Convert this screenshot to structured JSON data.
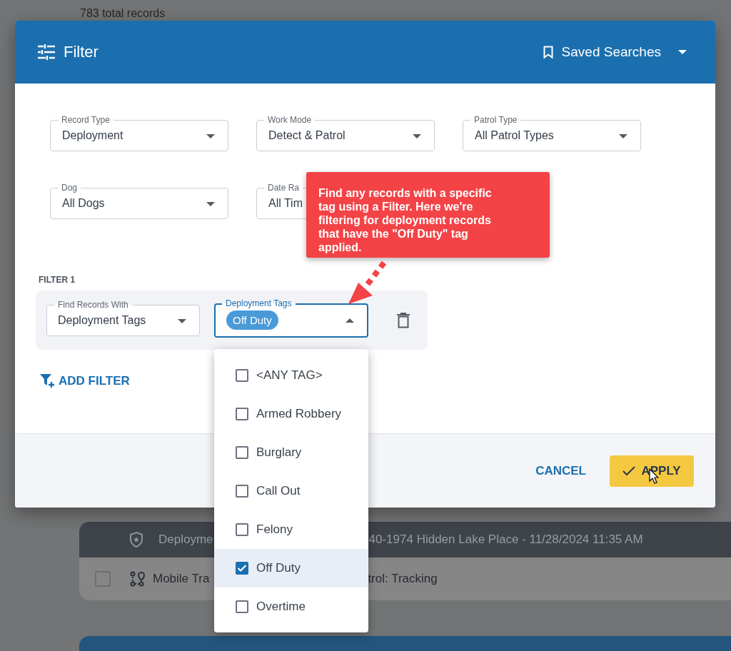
{
  "background": {
    "record_count": "783 total records",
    "record_card": {
      "header_left": "Deployme",
      "header_right": "40-1974 Hidden Lake Place - 11/28/2024 11:35 AM",
      "row_left": "Mobile Tra",
      "row_right": "trol: Tracking"
    }
  },
  "dialog": {
    "title": "Filter",
    "saved_searches": "Saved Searches",
    "fields": [
      {
        "label": "Record Type",
        "value": "Deployment"
      },
      {
        "label": "Work Mode",
        "value": "Detect & Patrol"
      },
      {
        "label": "Patrol Type",
        "value": "All Patrol Types"
      },
      {
        "label": "Dog",
        "value": "All Dogs"
      },
      {
        "label": "Date Ra",
        "value": "All Tim"
      }
    ],
    "callout": "Find any records with a specific tag using a Filter. Here we're filtering for deployment records that have the \"Off Duty\" tag applied.",
    "filters": [
      {
        "heading": "FILTER 1",
        "find_with": {
          "label": "Find Records With",
          "value": "Deployment Tags"
        },
        "tags_field": {
          "label": "Deployment Tags",
          "chips": [
            "Off Duty"
          ],
          "expanded": true
        }
      }
    ],
    "add_filter": "ADD FILTER",
    "buttons": {
      "cancel": "CANCEL",
      "apply": "APPLY"
    }
  },
  "dropdown": {
    "options": [
      {
        "label": "<ANY TAG>",
        "checked": false,
        "selected": false
      },
      {
        "label": "Armed Robbery",
        "checked": false,
        "selected": false
      },
      {
        "label": "Burglary",
        "checked": false,
        "selected": false
      },
      {
        "label": "Call Out",
        "checked": false,
        "selected": false
      },
      {
        "label": "Felony",
        "checked": false,
        "selected": false
      },
      {
        "label": "Off Duty",
        "checked": true,
        "selected": true
      },
      {
        "label": "Overtime",
        "checked": false,
        "selected": false
      }
    ]
  }
}
